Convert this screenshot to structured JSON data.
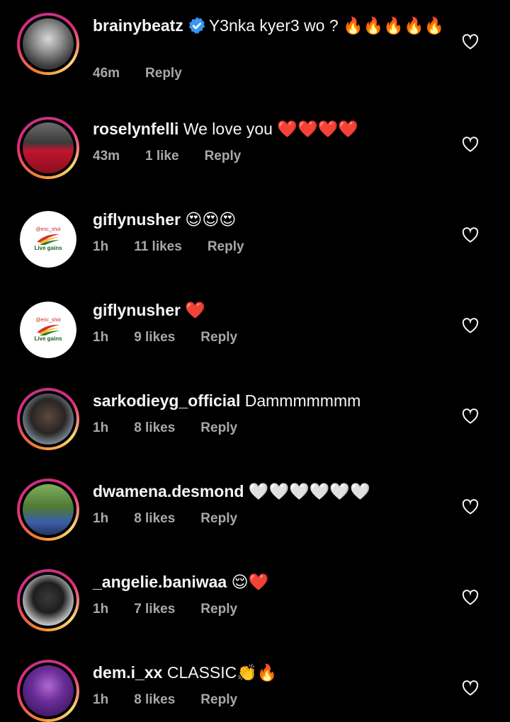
{
  "colors": {
    "background": "#000000",
    "text": "#f5f5f5",
    "meta": "#a8a8a8",
    "verified": "#3897f0"
  },
  "comments": [
    {
      "username": "brainybeatz",
      "verified": true,
      "text": "Y3nka kyer3 wo ?",
      "emoji": "🔥🔥🔥🔥🔥",
      "time": "46m",
      "likes": "",
      "reply": "Reply"
    },
    {
      "username": "roselynfelli",
      "text": "We love you",
      "emoji": "❤️❤️❤️❤️",
      "time": "43m",
      "likes": "1 like",
      "reply": "Reply"
    },
    {
      "username": "giflynusher",
      "text": "",
      "emoji": "😍😍😍",
      "time": "1h",
      "likes": "11 likes",
      "reply": "Reply",
      "avatar_top": "@eric_shol",
      "avatar_bottom": "Live gains"
    },
    {
      "username": "giflynusher",
      "text": "",
      "emoji": "❤️",
      "time": "1h",
      "likes": "9 likes",
      "reply": "Reply",
      "avatar_top": "@eric_shol",
      "avatar_bottom": "Live gains"
    },
    {
      "username": "sarkodieyg_official",
      "text": "Dammmmmmm",
      "emoji": "",
      "time": "1h",
      "likes": "8 likes",
      "reply": "Reply"
    },
    {
      "username": "dwamena.desmond",
      "text": "",
      "emoji": "🤍🤍🤍🤍🤍🤍",
      "time": "1h",
      "likes": "8 likes",
      "reply": "Reply"
    },
    {
      "username": "_angelie.baniwaa",
      "text": "",
      "emoji": "😌❤️",
      "time": "1h",
      "likes": "7 likes",
      "reply": "Reply"
    },
    {
      "username": "dem.i_xx",
      "text": "CLASSIC",
      "emoji": "👏🔥",
      "time": "1h",
      "likes": "8 likes",
      "reply": "Reply"
    }
  ]
}
